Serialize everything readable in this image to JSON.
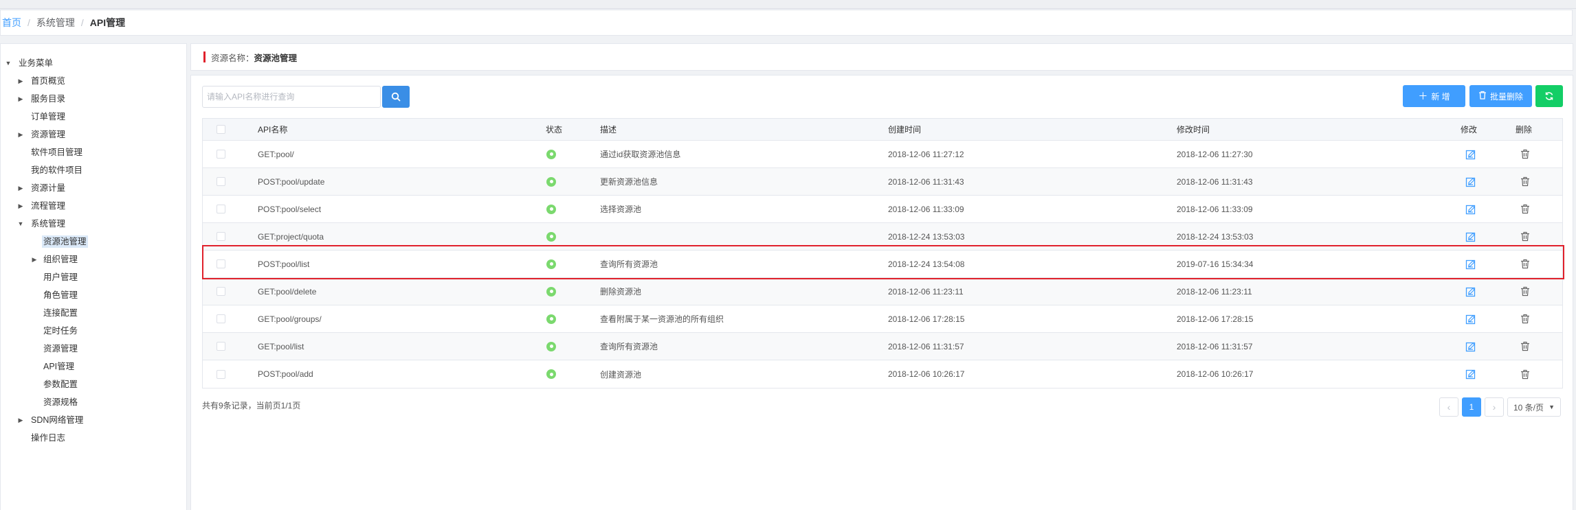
{
  "breadcrumb": {
    "home": "首页",
    "section": "系统管理",
    "current": "API管理"
  },
  "sidebar": {
    "items": [
      {
        "label": "业务菜单",
        "expanded": true
      },
      {
        "label": "首页概览",
        "arrow": true
      },
      {
        "label": "服务目录",
        "arrow": true
      },
      {
        "label": "订单管理"
      },
      {
        "label": "资源管理",
        "arrow": true
      },
      {
        "label": "软件项目管理"
      },
      {
        "label": "我的软件项目"
      },
      {
        "label": "资源计量",
        "arrow": true
      },
      {
        "label": "流程管理",
        "arrow": true
      },
      {
        "label": "系统管理",
        "expanded": true
      },
      {
        "label": "资源池管理",
        "selected": true
      },
      {
        "label": "组织管理",
        "arrow": true
      },
      {
        "label": "用户管理"
      },
      {
        "label": "角色管理"
      },
      {
        "label": "连接配置"
      },
      {
        "label": "定时任务"
      },
      {
        "label": "资源管理"
      },
      {
        "label": "API管理"
      },
      {
        "label": "参数配置"
      },
      {
        "label": "资源规格"
      },
      {
        "label": "SDN网络管理",
        "arrow": true
      },
      {
        "label": "操作日志"
      }
    ]
  },
  "resource_header": {
    "key": "资源名称：",
    "value": "资源池管理"
  },
  "toolbar": {
    "search_placeholder": "请输入API名称进行查询",
    "add_label": "新 增",
    "batch_delete_label": "批量删除"
  },
  "table": {
    "headers": {
      "name": "API名称",
      "status": "状态",
      "desc": "描述",
      "created": "创建时间",
      "modified": "修改时间",
      "edit": "修改",
      "delete": "删除"
    },
    "rows": [
      {
        "name": "GET:pool/",
        "desc": "通过id获取资源池信息",
        "created": "2018-12-06 11:27:12",
        "modified": "2018-12-06 11:27:30"
      },
      {
        "name": "POST:pool/update",
        "desc": "更新资源池信息",
        "created": "2018-12-06 11:31:43",
        "modified": "2018-12-06 11:31:43"
      },
      {
        "name": "POST:pool/select",
        "desc": "选择资源池",
        "created": "2018-12-06 11:33:09",
        "modified": "2018-12-06 11:33:09"
      },
      {
        "name": "GET:project/quota",
        "desc": "",
        "created": "2018-12-24 13:53:03",
        "modified": "2018-12-24 13:53:03"
      },
      {
        "name": "POST:pool/list",
        "desc": "查询所有资源池",
        "created": "2018-12-24 13:54:08",
        "modified": "2019-07-16 15:34:34"
      },
      {
        "name": "GET:pool/delete",
        "desc": "删除资源池",
        "created": "2018-12-06 11:23:11",
        "modified": "2018-12-06 11:23:11"
      },
      {
        "name": "GET:pool/groups/",
        "desc": "查看附属于某一资源池的所有组织",
        "created": "2018-12-06 17:28:15",
        "modified": "2018-12-06 17:28:15"
      },
      {
        "name": "GET:pool/list",
        "desc": "查询所有资源池",
        "created": "2018-12-06 11:31:57",
        "modified": "2018-12-06 11:31:57"
      },
      {
        "name": "POST:pool/add",
        "desc": "创建资源池",
        "created": "2018-12-06 10:26:17",
        "modified": "2018-12-06 10:26:17"
      }
    ]
  },
  "footer": {
    "summary": "共有9条记录，当前页1/1页",
    "current_page": "1",
    "page_size": "10 条/页"
  },
  "colors": {
    "primary": "#409eff",
    "success": "#13ce66",
    "highlight": "#e0202b",
    "status_on": "#7bd96e"
  }
}
